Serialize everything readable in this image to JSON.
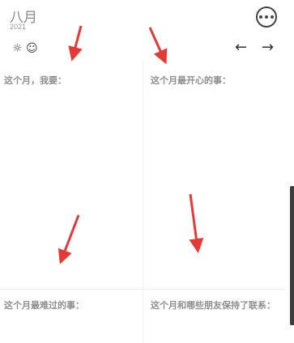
{
  "header": {
    "month": "八月",
    "year": "2021"
  },
  "toolbar": {
    "icons": [
      "sun-icon",
      "smile-icon",
      "arrow-left-icon",
      "arrow-right-icon",
      "more-icon"
    ],
    "sun_glyph": "☼",
    "smile_glyph": "☺",
    "prev_glyph": "←",
    "next_glyph": "→"
  },
  "prompts": {
    "want": "这个月，我要：",
    "happiest": "这个月最开心的事：",
    "saddest": "这个月最难过的事：",
    "friends": "这个月和哪些朋友保持了联系："
  },
  "colors": {
    "annotation_arrow": "#e53935",
    "label_text": "#8f8f8f"
  }
}
